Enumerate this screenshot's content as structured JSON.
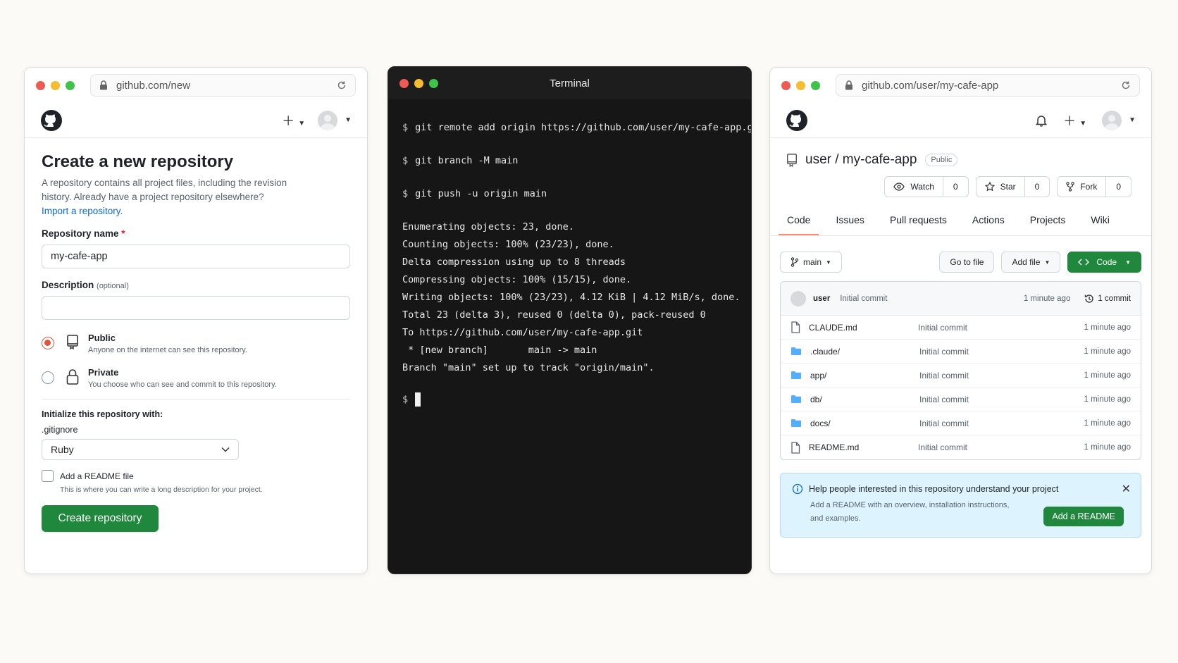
{
  "new_repo_window": {
    "url": "github.com/new",
    "title": "Create a new repository",
    "description_line1": "A repository contains all project files, including the revision",
    "description_line2": "history. Already have a project repository elsewhere?",
    "import_link": "Import a repository.",
    "repo_name_label": "Repository name",
    "required_mark": "*",
    "repo_name_value": "my-cafe-app",
    "description_label": "Description",
    "optional_label": "(optional)",
    "description_value": "",
    "public_title": "Public",
    "public_sub": "Anyone on the internet can see this repository.",
    "private_title": "Private",
    "private_sub": "You choose who can see and commit to this repository.",
    "initialize_label": "Initialize this repository with:",
    "gitignore_label": ".gitignore",
    "gitignore_value": "Ruby",
    "readme_label": "Add a README file",
    "readme_sub": "This is where you can write a long description for your project.",
    "create_button": "Create repository"
  },
  "terminal": {
    "title": "Terminal",
    "prompt": "$",
    "commands": [
      "git remote add origin https://github.com/user/my-cafe-app.git",
      "git branch -M main",
      "git push -u origin main"
    ],
    "output": [
      "Enumerating objects: 23, done.",
      "Counting objects: 100% (23/23), done.",
      "Delta compression using up to 8 threads",
      "Compressing objects: 100% (15/15), done.",
      "Writing objects: 100% (23/23), 4.12 KiB | 4.12 MiB/s, done.",
      "Total 23 (delta 3), reused 0 (delta 0), pack-reused 0",
      "To https://github.com/user/my-cafe-app.git",
      " * [new branch]       main -> main",
      "Branch \"main\" set up to track \"origin/main\"."
    ]
  },
  "repo_window": {
    "url": "github.com/user/my-cafe-app",
    "repo_path": "user / my-cafe-app",
    "visibility": "Public",
    "watch_label": "Watch",
    "watch_count": "0",
    "star_label": "Star",
    "star_count": "0",
    "fork_label": "Fork",
    "fork_count": "0",
    "tabs": [
      "Code",
      "Issues",
      "Pull requests",
      "Actions",
      "Projects",
      "Wiki"
    ],
    "branch": "main",
    "go_to_file": "Go to file",
    "add_file": "Add file",
    "code_button": "Code",
    "commit_user": "user",
    "commit_message": "Initial commit",
    "commit_time": "1 minute ago",
    "commit_count": "1 commit",
    "files": [
      {
        "name": "CLAUDE.md",
        "type": "file",
        "message": "Initial commit",
        "time": "1 minute ago"
      },
      {
        "name": ".claude/",
        "type": "folder",
        "message": "Initial commit",
        "time": "1 minute ago"
      },
      {
        "name": "app/",
        "type": "folder",
        "message": "Initial commit",
        "time": "1 minute ago"
      },
      {
        "name": "db/",
        "type": "folder",
        "message": "Initial commit",
        "time": "1 minute ago"
      },
      {
        "name": "docs/",
        "type": "folder",
        "message": "Initial commit",
        "time": "1 minute ago"
      },
      {
        "name": "README.md",
        "type": "file",
        "message": "Initial commit",
        "time": "1 minute ago"
      }
    ],
    "info_title": "Help people interested in this repository understand your project",
    "info_sub": "Add a README with an overview, installation instructions, and examples.",
    "info_button": "Add a README"
  },
  "colors": {
    "accent_green": "#1f883d",
    "link_blue": "#0969da",
    "folder_blue": "#54aeff",
    "radio_selected": "#e0533d",
    "terminal_bg": "#161616"
  },
  "icons": [
    "github-logo-icon",
    "lock-icon",
    "reload-icon",
    "plus-icon",
    "bell-icon",
    "repo-icon",
    "eye-icon",
    "star-icon",
    "fork-icon",
    "branch-icon",
    "history-icon",
    "file-icon",
    "folder-icon",
    "info-icon",
    "close-icon",
    "code-icon",
    "chevron-down-icon"
  ]
}
